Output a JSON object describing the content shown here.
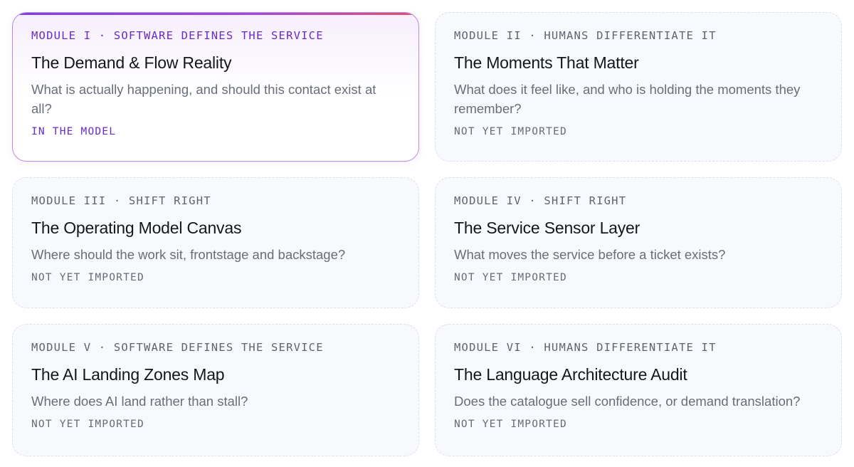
{
  "modules": [
    {
      "eyebrow": "MODULE I · SOFTWARE DEFINES THE SERVICE",
      "title": "The Demand & Flow Reality",
      "question": "What is actually happening, and should this contact exist at all?",
      "status": "IN THE MODEL",
      "active": true
    },
    {
      "eyebrow": "MODULE II · HUMANS DIFFERENTIATE IT",
      "title": "The Moments That Matter",
      "question": "What does it feel like, and who is holding the moments they remember?",
      "status": "NOT YET IMPORTED",
      "active": false
    },
    {
      "eyebrow": "MODULE III · SHIFT RIGHT",
      "title": "The Operating Model Canvas",
      "question": "Where should the work sit, frontstage and backstage?",
      "status": "NOT YET IMPORTED",
      "active": false
    },
    {
      "eyebrow": "MODULE IV · SHIFT RIGHT",
      "title": "The Service Sensor Layer",
      "question": "What moves the service before a ticket exists?",
      "status": "NOT YET IMPORTED",
      "active": false
    },
    {
      "eyebrow": "MODULE V · SOFTWARE DEFINES THE SERVICE",
      "title": "The AI Landing Zones Map",
      "question": "Where does AI land rather than stall?",
      "status": "NOT YET IMPORTED",
      "active": false
    },
    {
      "eyebrow": "MODULE VI · HUMANS DIFFERENTIATE IT",
      "title": "The Language Architecture Audit",
      "question": "Does the catalogue sell confidence, or demand translation?",
      "status": "NOT YET IMPORTED",
      "active": false
    }
  ],
  "colors": {
    "active_accent": "#6a2bc4",
    "active_border": "#b98ae6",
    "card_bg": "#f8f9fc",
    "card_border": "#dde1ec",
    "title_text": "#14161c",
    "body_text": "#6a6e78"
  }
}
